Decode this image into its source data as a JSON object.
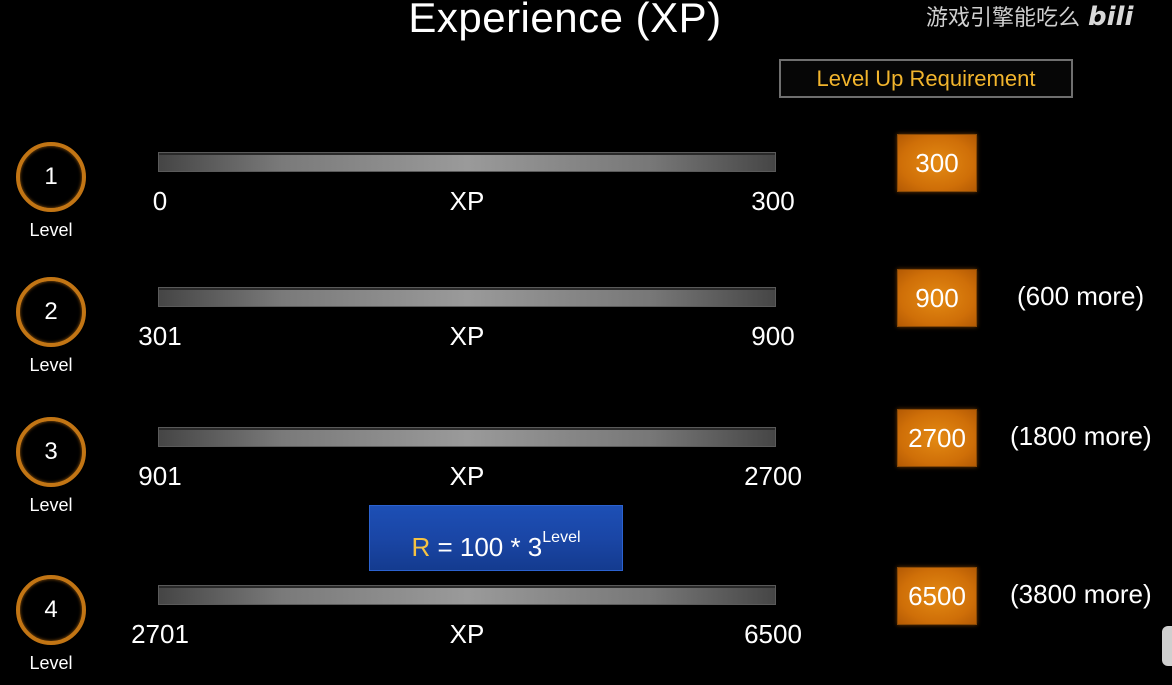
{
  "title": "Experience (XP)",
  "watermark": {
    "text": "游戏引擎能吃么",
    "logo": "bili"
  },
  "requirement_header": "Level Up Requirement",
  "levels": [
    {
      "number": "1",
      "word": "Level",
      "min": "0",
      "unit": "XP",
      "max": "300",
      "requirement": "300",
      "more": ""
    },
    {
      "number": "2",
      "word": "Level",
      "min": "301",
      "unit": "XP",
      "max": "900",
      "requirement": "900",
      "more": "(600 more)"
    },
    {
      "number": "3",
      "word": "Level",
      "min": "901",
      "unit": "XP",
      "max": "2700",
      "requirement": "2700",
      "more": "(1800 more)"
    },
    {
      "number": "4",
      "word": "Level",
      "min": "2701",
      "unit": "XP",
      "max": "6500",
      "requirement": "6500",
      "more": "(3800 more)"
    }
  ],
  "formula": {
    "r": "R",
    "body": " = 100 * 3",
    "exponent": "Level"
  },
  "colors": {
    "accent_orange": "#d0700a",
    "header_gold": "#f2b52d",
    "formula_blue": "#1a46a6",
    "background": "#000000"
  }
}
